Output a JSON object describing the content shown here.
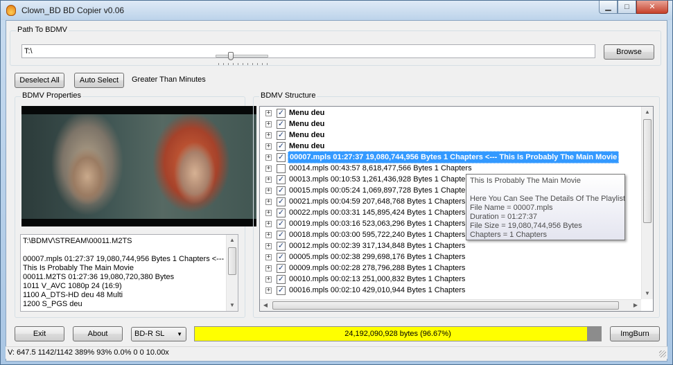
{
  "window": {
    "title": "Clown_BD BD Copier v0.06",
    "buttons": {
      "minimize": "▁",
      "maximize": "□",
      "close": "✕"
    }
  },
  "path_group": {
    "label": "Path To BDMV",
    "value": "T:\\",
    "browse_label": "Browse"
  },
  "controls": {
    "deselect_all": "Deselect All",
    "auto_select": "Auto Select",
    "greater_than_label": "Greater Than Minutes",
    "slider_value": 0.25
  },
  "properties": {
    "label": "BDMV Properties",
    "lines": [
      "T:\\BDMV\\STREAM\\00011.M2TS",
      "",
      "00007.mpls 01:27:37 19,080,744,956 Bytes 1 Chapters <---",
      "This Is Probably The Main Movie",
      "00011.M2TS 01:27:36 19,080,720,380 Bytes",
      "1011 V_AVC  1080p 24 (16:9)",
      "1100 A_DTS-HD deu 48 Multi",
      "1200 S_PGS deu"
    ]
  },
  "structure": {
    "label": "BDMV Structure",
    "rows": [
      {
        "text": "Menu deu",
        "checked": true,
        "style": "bold"
      },
      {
        "text": "Menu deu",
        "checked": true,
        "style": "bold"
      },
      {
        "text": "Menu deu",
        "checked": true,
        "style": "bold"
      },
      {
        "text": "Menu deu",
        "checked": true,
        "style": "bold"
      },
      {
        "text": "00007.mpls 01:27:37 19,080,744,956 Bytes 1 Chapters <--- This Is Probably The Main Movie",
        "checked": true,
        "style": "selected"
      },
      {
        "text": "00014.mpls 00:43:57 8,618,477,566 Bytes 1 Chapters",
        "checked": false,
        "style": "normal"
      },
      {
        "text": "00013.mpls 00:10:53 1,261,436,928 Bytes 1 Chapters",
        "checked": true,
        "style": "normal"
      },
      {
        "text": "00015.mpls 00:05:24 1,069,897,728 Bytes 1 Chapters",
        "checked": true,
        "style": "normal"
      },
      {
        "text": "00021.mpls 00:04:59 207,648,768 Bytes 1 Chapters",
        "checked": true,
        "style": "normal"
      },
      {
        "text": "00022.mpls 00:03:31 145,895,424 Bytes 1 Chapters",
        "checked": true,
        "style": "normal"
      },
      {
        "text": "00019.mpls 00:03:16 523,063,296 Bytes 1 Chapters",
        "checked": true,
        "style": "normal"
      },
      {
        "text": "00018.mpls 00:03:00 595,722,240 Bytes 1 Chapters",
        "checked": true,
        "style": "normal"
      },
      {
        "text": "00012.mpls 00:02:39 317,134,848 Bytes 1 Chapters",
        "checked": true,
        "style": "normal"
      },
      {
        "text": "00005.mpls 00:02:38 299,698,176 Bytes 1 Chapters",
        "checked": true,
        "style": "normal"
      },
      {
        "text": "00009.mpls 00:02:28 278,796,288 Bytes 1 Chapters",
        "checked": true,
        "style": "normal"
      },
      {
        "text": "00010.mpls 00:02:13 251,000,832 Bytes 1 Chapters",
        "checked": true,
        "style": "normal"
      },
      {
        "text": "00016.mpls 00:02:10 429,010,944 Bytes 1 Chapters",
        "checked": true,
        "style": "normal"
      }
    ]
  },
  "tooltip": {
    "lines": [
      "This Is Probably The Main Movie",
      "",
      "Here You Can See The Details Of The Playlist",
      "File Name = 00007.mpls",
      "Duration = 01:27:37",
      "File Size = 19,080,744,956 Bytes",
      "Chapters =  1 Chapters"
    ]
  },
  "bottom": {
    "exit_label": "Exit",
    "about_label": "About",
    "disc_type": "BD-R SL",
    "progress_text": "24,192,090,928 bytes (96.67%)",
    "progress_fraction": 0.9667,
    "imgburn_label": "ImgBurn"
  },
  "status": {
    "text": "V: 647.5 1142/1142 389% 93%  0.0% 0 0 10.00x"
  },
  "colors": {
    "progress_fill": "#ffff00",
    "selection": "#3399ff"
  }
}
